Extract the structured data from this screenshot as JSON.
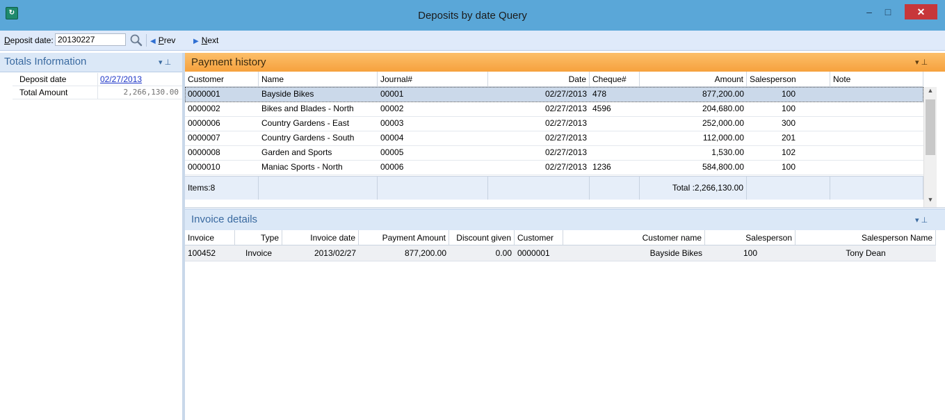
{
  "window": {
    "icon_name": "app-icon",
    "title": "Deposits by date Query",
    "minimize_glyph": "–",
    "maximize_glyph": "□",
    "close_glyph": "✕"
  },
  "toolbar": {
    "deposit_label_key": "D",
    "deposit_label_rest": "eposit date:",
    "deposit_value": "20130227",
    "prev_key": "P",
    "prev_rest": "rev",
    "next_key": "N",
    "next_rest": "ext"
  },
  "totals": {
    "title": "Totals Information",
    "deposit_date_label": "Deposit date",
    "deposit_date_value": "02/27/2013",
    "total_amount_label": "Total Amount",
    "total_amount_value": "2,266,130.00"
  },
  "payment": {
    "title": "Payment history",
    "columns": [
      "Customer",
      "Name",
      "Journal#",
      "Date",
      "Cheque#",
      "Amount",
      "Salesperson",
      "Note"
    ],
    "rows": [
      [
        "0000001",
        "Bayside Bikes",
        "00001",
        "02/27/2013",
        "478",
        "877,200.00",
        "100",
        ""
      ],
      [
        "0000002",
        "Bikes and Blades - North",
        "00002",
        "02/27/2013",
        "4596",
        "204,680.00",
        "100",
        ""
      ],
      [
        "0000006",
        "Country Gardens - East",
        "00003",
        "02/27/2013",
        "",
        "252,000.00",
        "300",
        ""
      ],
      [
        "0000007",
        "Country Gardens - South",
        "00004",
        "02/27/2013",
        "",
        "112,000.00",
        "201",
        ""
      ],
      [
        "0000008",
        "Garden and Sports",
        "00005",
        "02/27/2013",
        "",
        "1,530.00",
        "102",
        ""
      ],
      [
        "0000010",
        "Maniac Sports - North",
        "00006",
        "02/27/2013",
        "1236",
        "584,800.00",
        "100",
        ""
      ]
    ],
    "items_label": "Items:8",
    "total_label": "Total :2,266,130.00"
  },
  "invoice": {
    "title": "Invoice details",
    "columns": [
      "Invoice",
      "Type",
      "Invoice date",
      "Payment Amount",
      "Discount given",
      "Customer",
      "Customer name",
      "Salesperson",
      "Salesperson Name"
    ],
    "rows": [
      [
        "100452",
        "Invoice",
        "2013/02/27",
        "877,200.00",
        "0.00",
        "0000001",
        "Bayside Bikes",
        "100",
        "Tony Dean"
      ]
    ]
  },
  "colors": {
    "titlebar": "#5aa7d8",
    "payment_header": "#f6a13d",
    "panel_header": "#dbe8f7",
    "close_button": "#c7373a"
  }
}
